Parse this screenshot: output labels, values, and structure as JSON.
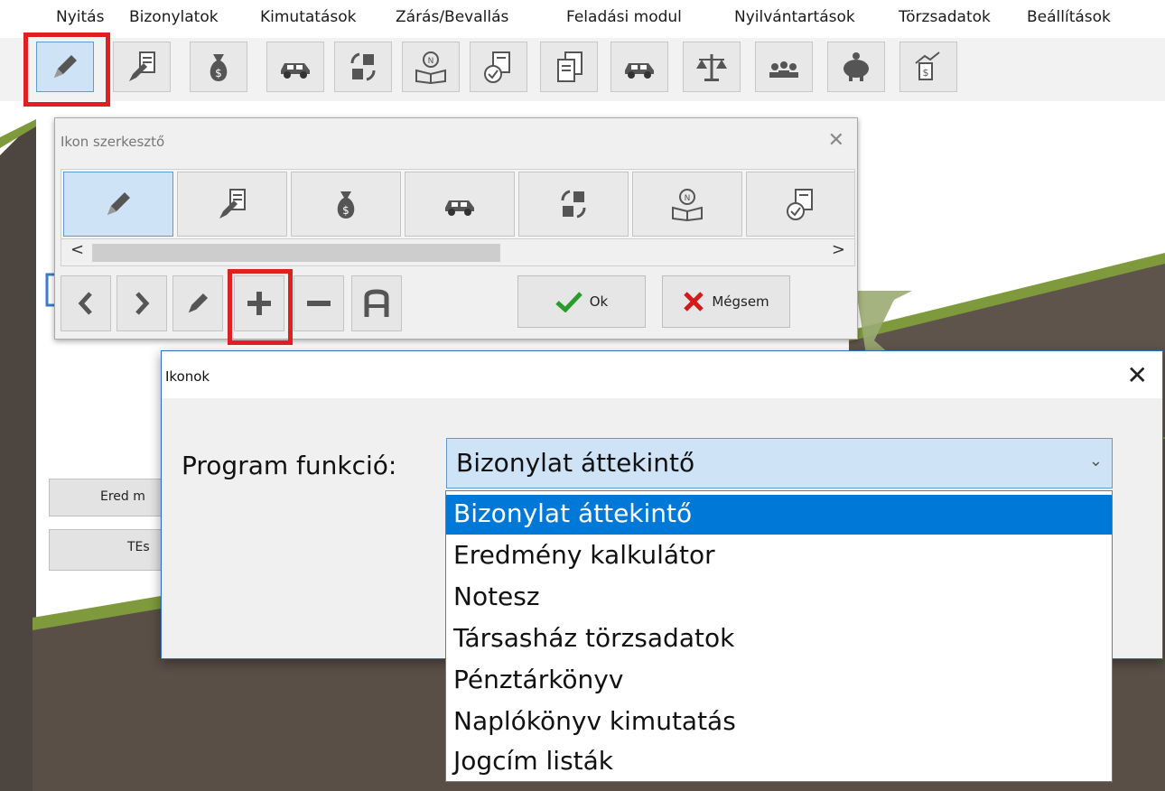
{
  "menu": [
    "Nyitás",
    "Bizonylatok",
    "Kimutatások",
    "Zárás/Bevallás",
    "Feladási modul",
    "Nyilvántartások",
    "Törzsadatok",
    "Beállítások"
  ],
  "toolbar": {
    "icons": [
      "pencil-icon",
      "document-edit-icon",
      "money-bag-icon",
      "car-icon",
      "boxes-exchange-icon",
      "ledger-book-icon",
      "document-check-icon",
      "documents-icon",
      "car-icon",
      "balance-scale-icon",
      "people-group-icon",
      "piggy-bank-icon",
      "money-growth-icon"
    ]
  },
  "background": {
    "buttons": [
      "Ered m",
      "TEs"
    ]
  },
  "editor": {
    "title": "Ikon szerkesztő",
    "close": "✕",
    "icons": [
      "pencil-icon",
      "document-edit-icon",
      "money-bag-icon",
      "car-icon",
      "boxes-exchange-icon",
      "ledger-book-icon",
      "document-check-icon"
    ],
    "scroll_left": "<",
    "scroll_right": ">",
    "ok_label": "Ok",
    "cancel_label": "Mégsem"
  },
  "ikonok": {
    "title": "Ikonok",
    "close": "✕",
    "label": "Program funkció:",
    "selected": "Bizonylat áttekintő",
    "options": [
      "Bizonylat áttekintő",
      "Eredmény kalkulátor",
      "Notesz",
      "Társasház törzsadatok",
      "Pénztárkönyv",
      "Naplókönyv kimutatás",
      "Jogcím listák"
    ]
  },
  "colors": {
    "highlight": "#0078d7",
    "selected_bg": "#cfe3f7",
    "annotation_red": "#e02020",
    "olive_green": "#7e9a3c"
  }
}
